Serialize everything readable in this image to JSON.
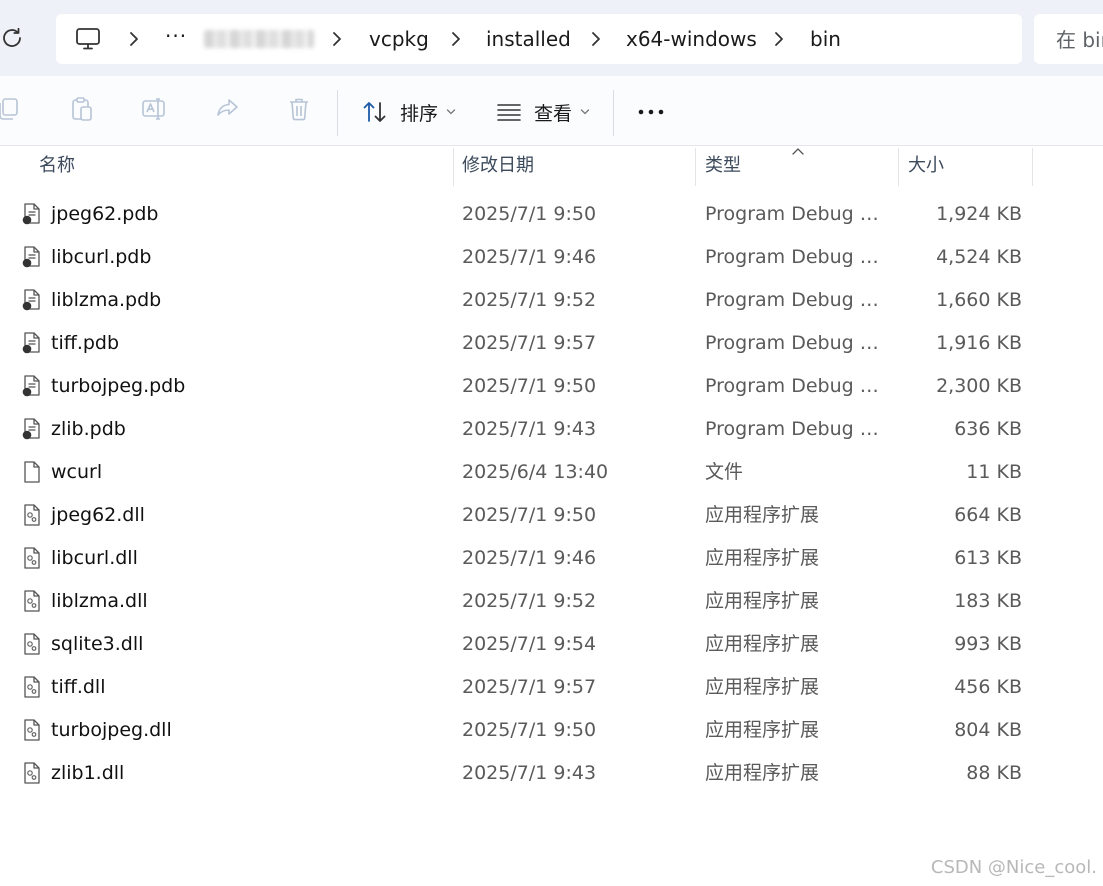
{
  "address_bar": {
    "breadcrumb": [
      "vcpkg",
      "installed",
      "x64-windows",
      "bin"
    ],
    "overflow_label": "···",
    "search_placeholder": "在 bin"
  },
  "commands": {
    "sort_label": "排序",
    "view_label": "查看"
  },
  "columns": {
    "name": "名称",
    "date": "修改日期",
    "type": "类型",
    "size": "大小"
  },
  "files": [
    {
      "name": "jpeg62.pdb",
      "date": "2025/7/1 9:50",
      "type": "Program Debug Da...",
      "size": "1,924 KB",
      "icon": "pdb-file-icon"
    },
    {
      "name": "libcurl.pdb",
      "date": "2025/7/1 9:46",
      "type": "Program Debug Da...",
      "size": "4,524 KB",
      "icon": "pdb-file-icon"
    },
    {
      "name": "liblzma.pdb",
      "date": "2025/7/1 9:52",
      "type": "Program Debug Da...",
      "size": "1,660 KB",
      "icon": "pdb-file-icon"
    },
    {
      "name": "tiff.pdb",
      "date": "2025/7/1 9:57",
      "type": "Program Debug Da...",
      "size": "1,916 KB",
      "icon": "pdb-file-icon"
    },
    {
      "name": "turbojpeg.pdb",
      "date": "2025/7/1 9:50",
      "type": "Program Debug Da...",
      "size": "2,300 KB",
      "icon": "pdb-file-icon"
    },
    {
      "name": "zlib.pdb",
      "date": "2025/7/1 9:43",
      "type": "Program Debug Da...",
      "size": "636 KB",
      "icon": "pdb-file-icon"
    },
    {
      "name": "wcurl",
      "date": "2025/6/4 13:40",
      "type": "文件",
      "size": "11 KB",
      "icon": "blank-file-icon"
    },
    {
      "name": "jpeg62.dll",
      "date": "2025/7/1 9:50",
      "type": "应用程序扩展",
      "size": "664 KB",
      "icon": "dll-file-icon"
    },
    {
      "name": "libcurl.dll",
      "date": "2025/7/1 9:46",
      "type": "应用程序扩展",
      "size": "613 KB",
      "icon": "dll-file-icon"
    },
    {
      "name": "liblzma.dll",
      "date": "2025/7/1 9:52",
      "type": "应用程序扩展",
      "size": "183 KB",
      "icon": "dll-file-icon"
    },
    {
      "name": "sqlite3.dll",
      "date": "2025/7/1 9:54",
      "type": "应用程序扩展",
      "size": "993 KB",
      "icon": "dll-file-icon"
    },
    {
      "name": "tiff.dll",
      "date": "2025/7/1 9:57",
      "type": "应用程序扩展",
      "size": "456 KB",
      "icon": "dll-file-icon"
    },
    {
      "name": "turbojpeg.dll",
      "date": "2025/7/1 9:50",
      "type": "应用程序扩展",
      "size": "804 KB",
      "icon": "dll-file-icon"
    },
    {
      "name": "zlib1.dll",
      "date": "2025/7/1 9:43",
      "type": "应用程序扩展",
      "size": "88 KB",
      "icon": "dll-file-icon"
    }
  ],
  "watermark": "CSDN @Nice_cool.",
  "colors": {
    "topbar_bg": "#eef2f8",
    "accent": "#1f5aa8",
    "secondary_text": "#5a5a5a"
  }
}
